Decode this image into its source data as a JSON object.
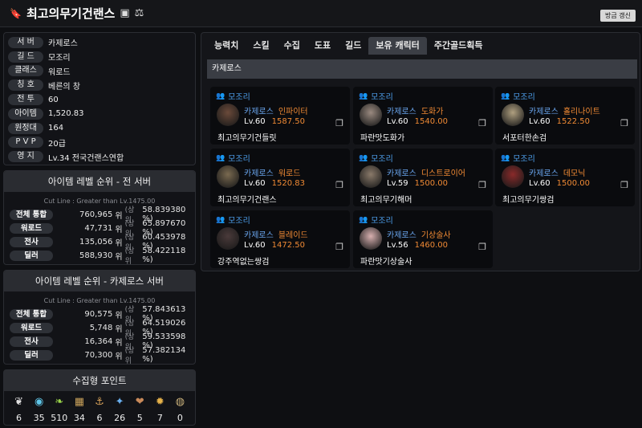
{
  "header": {
    "title": "최고의무기건랜스",
    "refresh_label": "방금 갱신"
  },
  "info": [
    {
      "label": "서 버",
      "value": "카제로스"
    },
    {
      "label": "길 드",
      "value": "모조리"
    },
    {
      "label": "클래스",
      "value": "워로드"
    },
    {
      "label": "칭 호",
      "value": "베른의 창"
    },
    {
      "label": "전 투",
      "value": "60"
    },
    {
      "label": "아이템",
      "value": "1,520.83"
    },
    {
      "label": "원정대",
      "value": "164"
    },
    {
      "label": "P V P",
      "value": "20급"
    },
    {
      "label": "영 지",
      "value": "Lv.34 전국건랜스연합"
    }
  ],
  "rank_all": {
    "title": "아이템 레벨 순위 - 전 서버",
    "cutline": "Cut Line : Greater than Lv.1475.00",
    "rows": [
      {
        "label": "전체 통합",
        "rank": "760,965",
        "unit": "위",
        "top": "(상위",
        "pct": "58.839380 %)"
      },
      {
        "label": "워로드",
        "rank": "47,731",
        "unit": "위",
        "top": "(상위",
        "pct": "65.897670 %)"
      },
      {
        "label": "전사",
        "rank": "135,056",
        "unit": "위",
        "top": "(상위",
        "pct": "60.453978 %)"
      },
      {
        "label": "딜러",
        "rank": "588,930",
        "unit": "위",
        "top": "(상위",
        "pct": "58.422118 %)"
      }
    ]
  },
  "rank_server": {
    "title": "아이템 레벨 순위 - 카제로스 서버",
    "cutline": "Cut Line : Greater than Lv.1475.00",
    "rows": [
      {
        "label": "전체 통합",
        "rank": "90,575",
        "unit": "위",
        "top": "(상위",
        "pct": "57.843613 %)"
      },
      {
        "label": "워로드",
        "rank": "5,748",
        "unit": "위",
        "top": "(상위",
        "pct": "64.519026 %)"
      },
      {
        "label": "전사",
        "rank": "16,364",
        "unit": "위",
        "top": "(상위",
        "pct": "59.533598 %)"
      },
      {
        "label": "딜러",
        "rank": "70,300",
        "unit": "위",
        "top": "(상위",
        "pct": "57.382134 %)"
      }
    ]
  },
  "collection": {
    "title": "수집형 포인트",
    "items": [
      {
        "icon": "seed-icon",
        "count": "6",
        "color": "#e0e0e0"
      },
      {
        "icon": "island-heart-icon",
        "count": "35",
        "color": "#5fc6e8"
      },
      {
        "icon": "mokoko-seed-icon",
        "count": "510",
        "color": "#9bd64a"
      },
      {
        "icon": "painting-icon",
        "count": "34",
        "color": "#c9a15a"
      },
      {
        "icon": "ship-icon",
        "count": "6",
        "color": "#d9a35a"
      },
      {
        "icon": "star-icon",
        "count": "26",
        "color": "#6ab0f0"
      },
      {
        "icon": "giant-heart-icon",
        "count": "5",
        "color": "#c98a5a"
      },
      {
        "icon": "sun-icon",
        "count": "7",
        "color": "#e6b24a"
      },
      {
        "icon": "orb-icon",
        "count": "0",
        "color": "#c9b07a"
      }
    ]
  },
  "tabs": [
    "능력치",
    "스킬",
    "수집",
    "도표",
    "길드",
    "보유 캐릭터",
    "주간골드획득"
  ],
  "active_tab": 5,
  "server_bar": "카제로스",
  "characters": [
    {
      "guild": "모조리",
      "server": "카제로스",
      "class": "인파이터",
      "level": "Lv.60",
      "ilvl": "1587.50",
      "name": "최고의무기건들릿",
      "avatar": "#6b4a3a"
    },
    {
      "guild": "모조리",
      "server": "카제로스",
      "class": "도화가",
      "level": "Lv.60",
      "ilvl": "1540.00",
      "name": "파란맛도화가",
      "avatar": "#9a8a80"
    },
    {
      "guild": "모조리",
      "server": "카제로스",
      "class": "홀리나이트",
      "level": "Lv.60",
      "ilvl": "1522.50",
      "name": "서포터한손검",
      "avatar": "#b0a080"
    },
    {
      "guild": "모조리",
      "server": "카제로스",
      "class": "워로드",
      "level": "Lv.60",
      "ilvl": "1520.83",
      "name": "최고의무기건랜스",
      "avatar": "#7a6a50"
    },
    {
      "guild": "모조리",
      "server": "카제로스",
      "class": "디스트로이어",
      "level": "Lv.59",
      "ilvl": "1500.00",
      "name": "최고의무기해머",
      "avatar": "#8a7a6a"
    },
    {
      "guild": "모조리",
      "server": "카제로스",
      "class": "데모닉",
      "level": "Lv.60",
      "ilvl": "1500.00",
      "name": "최고의무기쌍검",
      "avatar": "#8a2a2a"
    },
    {
      "guild": "모조리",
      "server": "카제로스",
      "class": "블레이드",
      "level": "Lv.60",
      "ilvl": "1472.50",
      "name": "강주역없는쌍검",
      "avatar": "#4a3a3a"
    },
    {
      "guild": "모조리",
      "server": "카제로스",
      "class": "기상술사",
      "level": "Lv.56",
      "ilvl": "1460.00",
      "name": "파란맛기상술사",
      "avatar": "#d8b0b0"
    }
  ]
}
